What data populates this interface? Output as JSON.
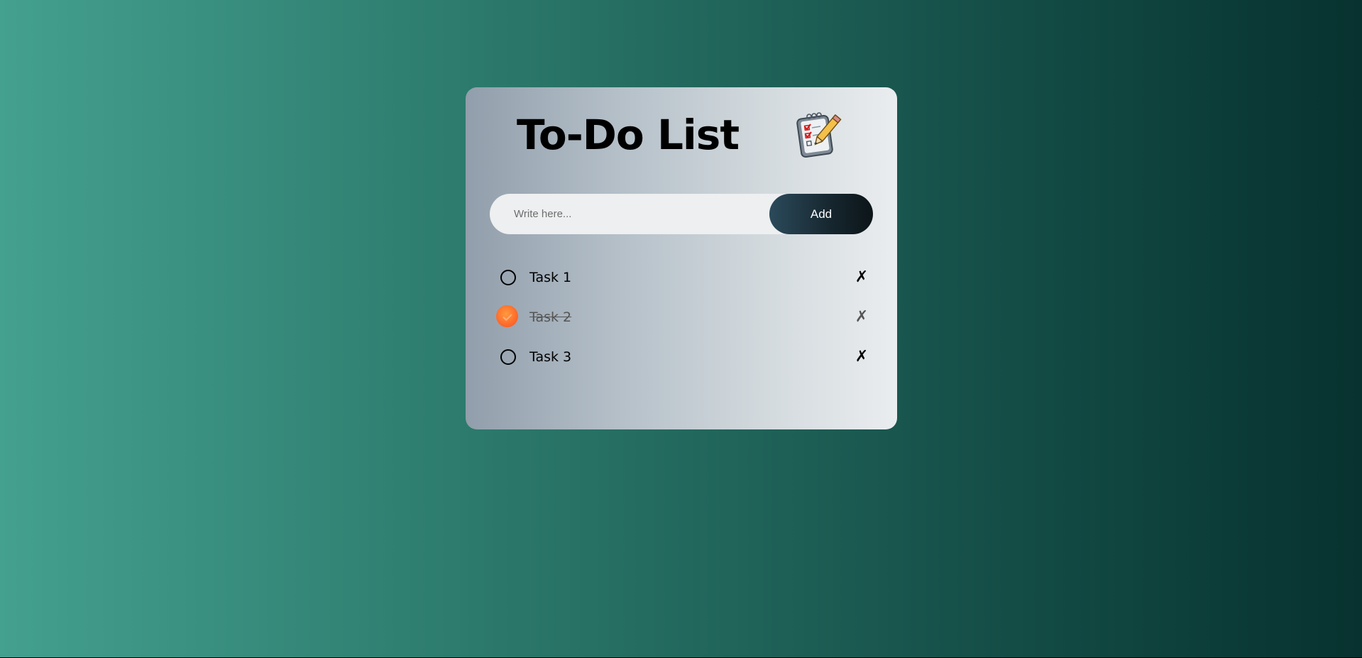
{
  "app": {
    "title": "To-Do List",
    "title_icon": "memo-clipboard-pencil-icon"
  },
  "input": {
    "placeholder": "Write here...",
    "value": ""
  },
  "add_button": {
    "label": "Add"
  },
  "tasks": [
    {
      "text": "Task 1",
      "completed": false,
      "delete_label": "✗"
    },
    {
      "text": "Task 2",
      "completed": true,
      "delete_label": "✗"
    },
    {
      "text": "Task 3",
      "completed": false,
      "delete_label": "✗"
    }
  ],
  "colors": {
    "page_gradient_start": "#44a08f",
    "page_gradient_end": "#07322f",
    "card_gradient_start": "#919eab",
    "card_gradient_end": "#eaedef",
    "add_button_start": "#2b4a5b",
    "add_button_end": "#0c1519",
    "checked_accent": "#ff6a2b"
  }
}
